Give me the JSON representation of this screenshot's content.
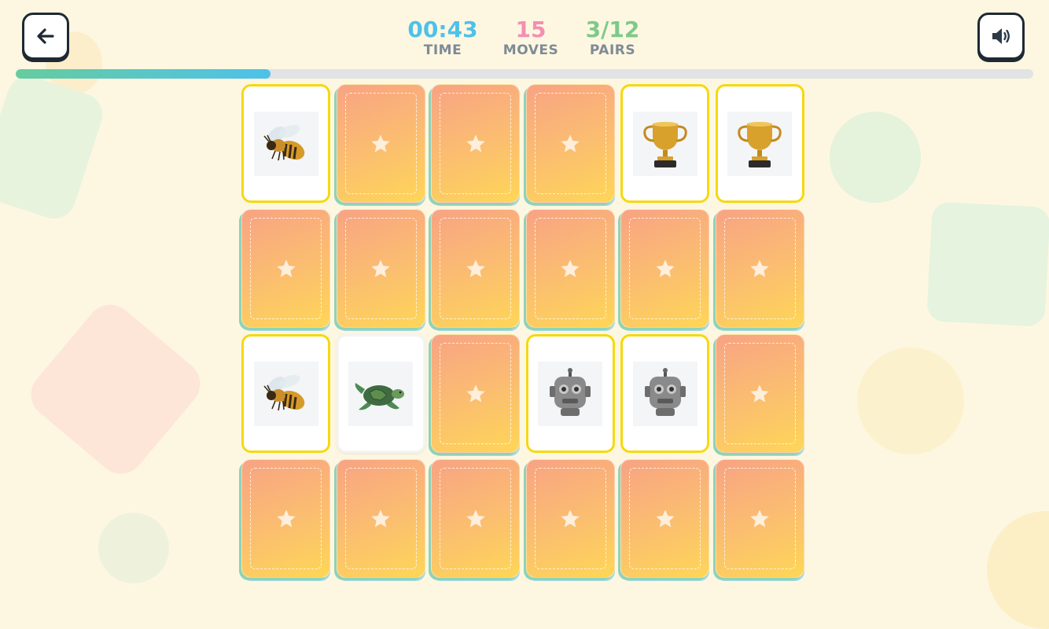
{
  "header": {
    "back_icon": "arrow-left-icon",
    "sound_icon": "speaker-volume-icon"
  },
  "stats": {
    "time": {
      "value": "00:43",
      "label": "TIME",
      "color": "#4ec1ea"
    },
    "moves": {
      "value": "15",
      "label": "MOVES",
      "color": "#f48fb1"
    },
    "pairs": {
      "value": "3/12",
      "label": "PAIRS",
      "color": "#7ec98a"
    }
  },
  "progress": {
    "fraction": 0.25
  },
  "board": {
    "rows": 4,
    "cols": 6,
    "cards": [
      {
        "state": "matched",
        "image": "bee"
      },
      {
        "state": "hidden"
      },
      {
        "state": "hidden"
      },
      {
        "state": "hidden"
      },
      {
        "state": "matched",
        "image": "trophy"
      },
      {
        "state": "matched",
        "image": "trophy"
      },
      {
        "state": "hidden"
      },
      {
        "state": "hidden"
      },
      {
        "state": "hidden"
      },
      {
        "state": "hidden"
      },
      {
        "state": "hidden"
      },
      {
        "state": "hidden"
      },
      {
        "state": "matched",
        "image": "bee"
      },
      {
        "state": "flipped",
        "image": "turtle"
      },
      {
        "state": "hidden"
      },
      {
        "state": "matched",
        "image": "robot"
      },
      {
        "state": "matched",
        "image": "robot"
      },
      {
        "state": "hidden"
      },
      {
        "state": "hidden"
      },
      {
        "state": "hidden"
      },
      {
        "state": "hidden"
      },
      {
        "state": "hidden"
      },
      {
        "state": "hidden"
      },
      {
        "state": "hidden"
      }
    ]
  },
  "colors": {
    "matched_border": "#f6d90e",
    "card_back_top": "#f8a383",
    "card_back_bottom": "#fed657"
  }
}
